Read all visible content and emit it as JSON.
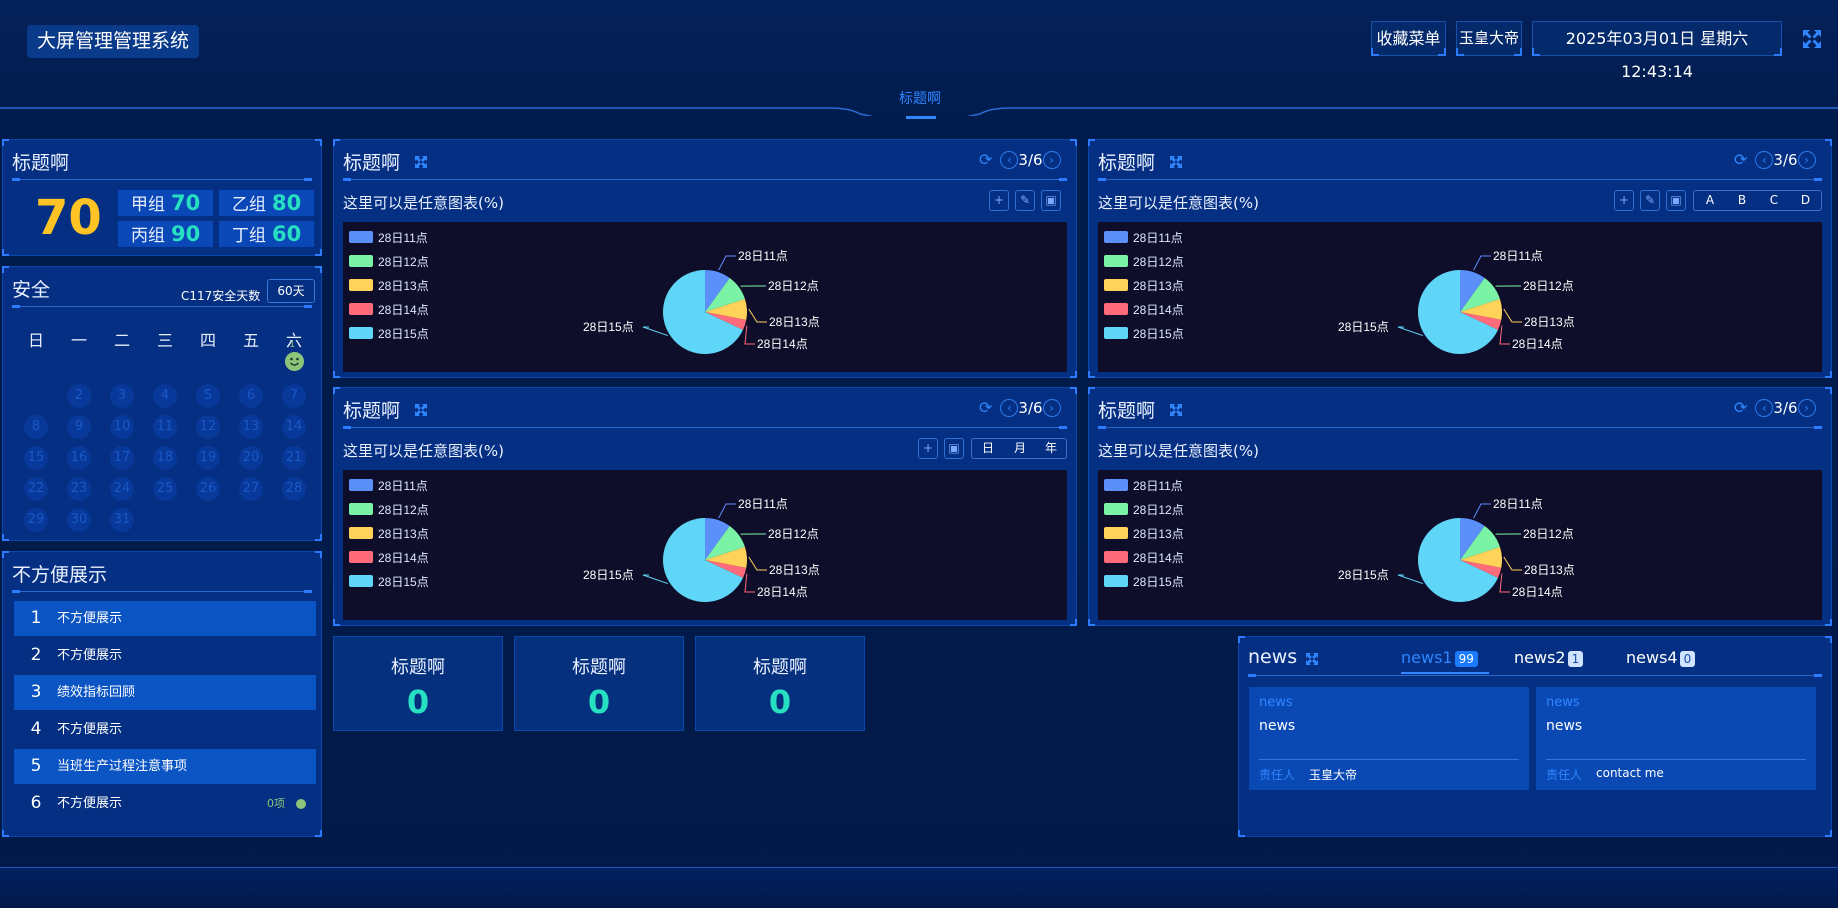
{
  "header": {
    "system_title": "大屏管理管理系统",
    "favorites_label": "收藏菜单",
    "user_label": "玉皇大帝",
    "datetime": "2025年03月01日 星期六 12:43:14",
    "center_tab": "标题啊"
  },
  "score_panel": {
    "title": "标题啊",
    "total": "70",
    "groups": [
      {
        "label": "甲组",
        "value": "70"
      },
      {
        "label": "乙组",
        "value": "80"
      },
      {
        "label": "丙组",
        "value": "90"
      },
      {
        "label": "丁组",
        "value": "60"
      }
    ]
  },
  "safety_panel": {
    "title": "安全",
    "days_label": "C117安全天数",
    "days_value": "60天",
    "weekdays": [
      "日",
      "一",
      "二",
      "三",
      "四",
      "五",
      "六"
    ],
    "first_day": "1",
    "days": [
      "2",
      "3",
      "4",
      "5",
      "6",
      "7",
      "8",
      "9",
      "10",
      "11",
      "12",
      "13",
      "14",
      "15",
      "16",
      "17",
      "18",
      "19",
      "20",
      "21",
      "22",
      "23",
      "24",
      "25",
      "26",
      "27",
      "28",
      "29",
      "30",
      "31"
    ]
  },
  "list_panel": {
    "title": "不方便展示",
    "items": [
      {
        "num": "1",
        "text": "不方便展示"
      },
      {
        "num": "2",
        "text": "不方便展示"
      },
      {
        "num": "3",
        "text": "绩效指标回顾"
      },
      {
        "num": "4",
        "text": "不方便展示"
      },
      {
        "num": "5",
        "text": "当班生产过程注意事项"
      },
      {
        "num": "6",
        "text": "不方便展示",
        "count": "0项"
      }
    ]
  },
  "chart_panels": [
    {
      "title": "标题啊",
      "pager": "3/6",
      "subtitle": "这里可以是任意图表(%)"
    },
    {
      "title": "标题啊",
      "pager": "3/6",
      "subtitle": "这里可以是任意图表(%)",
      "segments": [
        "A",
        "B",
        "C",
        "D"
      ]
    },
    {
      "title": "标题啊",
      "pager": "3/6",
      "subtitle": "这里可以是任意图表(%)",
      "segments": [
        "日",
        "月",
        "年"
      ]
    },
    {
      "title": "标题啊",
      "pager": "3/6",
      "subtitle": "这里可以是任意图表(%)"
    }
  ],
  "chart_data": {
    "type": "pie",
    "categories": [
      "28日11点",
      "28日12点",
      "28日13点",
      "28日14点",
      "28日15点"
    ],
    "values": [
      10,
      10,
      8,
      4,
      68
    ],
    "colors": [
      "#5b8ff9",
      "#7bf3a6",
      "#ffd35a",
      "#ff6b7a",
      "#5fd6f8"
    ]
  },
  "stats": [
    {
      "title": "标题啊",
      "value": "0"
    },
    {
      "title": "标题啊",
      "value": "0"
    },
    {
      "title": "标题啊",
      "value": "0"
    }
  ],
  "news_panel": {
    "title": "news",
    "tabs": [
      {
        "label": "news1",
        "badge": "99"
      },
      {
        "label": "news2",
        "badge": "1"
      },
      {
        "label": "news4",
        "badge": "0"
      }
    ],
    "cards": [
      {
        "category": "news",
        "content": "news",
        "owner_label": "责任人",
        "owner": "玉皇大帝"
      },
      {
        "category": "news",
        "content": "news",
        "owner_label": "责任人",
        "owner": "contact me"
      }
    ]
  }
}
